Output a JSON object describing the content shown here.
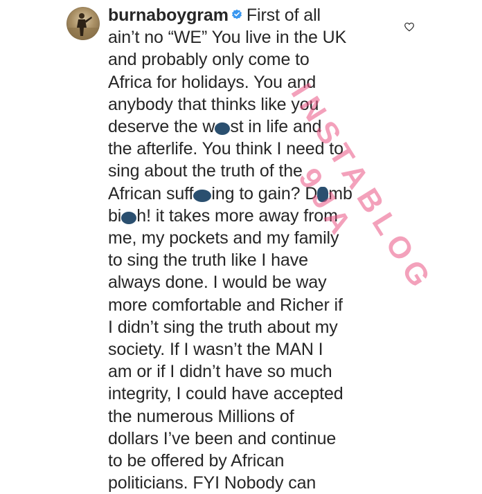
{
  "comment": {
    "username": "burnaboygram",
    "lines": [
      "First of all",
      "ain’t no “WE”  You live in the UK",
      "and probably only come to",
      "Africa for holidays. You and",
      "anybody that thinks like you",
      "deserve the w",
      "st in life and",
      "the afterlife. You think I need to",
      "sing about the truth of the",
      "African suff",
      "ing to gain? D",
      "mb",
      "bi",
      "h! it takes more away from",
      "me, my pockets and my family",
      "to sing the truth like I have",
      "always done. I would be way",
      "more comfortable and Richer if",
      "I didn’t sing the truth about my",
      "society. If I wasn’t the MAN I",
      "am or if I didn’t have so much",
      "integrity, I could have accepted",
      "the numerous Millions of",
      "dollars I’ve been and continue",
      "to be offered by African",
      "politicians. FYI Nobody can"
    ]
  },
  "watermark": {
    "lines": [
      "INSTABLOG",
      "9JA"
    ]
  },
  "icons": {
    "verified": "verified-badge-icon",
    "heart": "heart-outline-icon"
  },
  "colors": {
    "text": "#262626",
    "verified_blue": "#3897f0",
    "watermark_pink": "#e95484",
    "censor_blot": "#2a4f6f"
  }
}
